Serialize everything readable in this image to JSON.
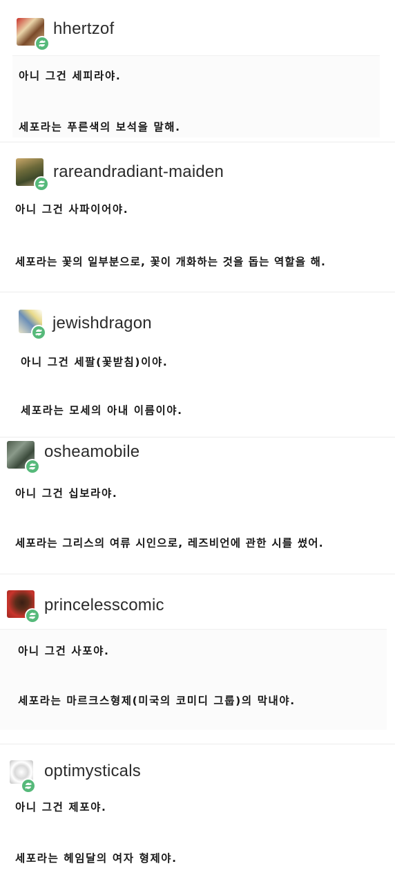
{
  "posts": [
    {
      "username": "hhertzof",
      "avatar_icon": "user-avatar",
      "badge_icon": "reblog-icon",
      "line1": "아니 그건 세피라야.",
      "line2": "세포라는 푸른색의 보석을 말해."
    },
    {
      "username": "rareandradiant-maiden",
      "avatar_icon": "user-avatar",
      "badge_icon": "reblog-icon",
      "line1": "아니 그건 사파이어야.",
      "line2": "세포라는 꽃의 일부분으로, 꽃이 개화하는 것을 돕는 역할을 해."
    },
    {
      "username": "jewishdragon",
      "avatar_icon": "user-avatar",
      "badge_icon": "reblog-icon",
      "line1": "아니 그건 세팔(꽃받침)이야.",
      "line2": "세포라는 모세의 아내 이름이야."
    },
    {
      "username": "osheamobile",
      "avatar_icon": "user-avatar",
      "badge_icon": "reblog-icon",
      "line1": "아니 그건 십보라야.",
      "line2": "세포라는 그리스의 여류 시인으로, 레즈비언에 관한 시를 썼어."
    },
    {
      "username": "princelesscomic",
      "avatar_icon": "user-avatar",
      "badge_icon": "reblog-icon",
      "line1": "아니 그건 사포야.",
      "line2": "세포라는 마르크스형제(미국의 코미디 그룹)의 막내야."
    },
    {
      "username": "optimysticals",
      "avatar_icon": "user-avatar",
      "badge_icon": "reblog-icon",
      "line1": "아니 그건 제포야.",
      "line2": "세포라는 헤임달의 여자 형제야."
    }
  ],
  "colors": {
    "reblog": "#56b97a",
    "username": "#2b2b2b",
    "text": "#161616"
  }
}
